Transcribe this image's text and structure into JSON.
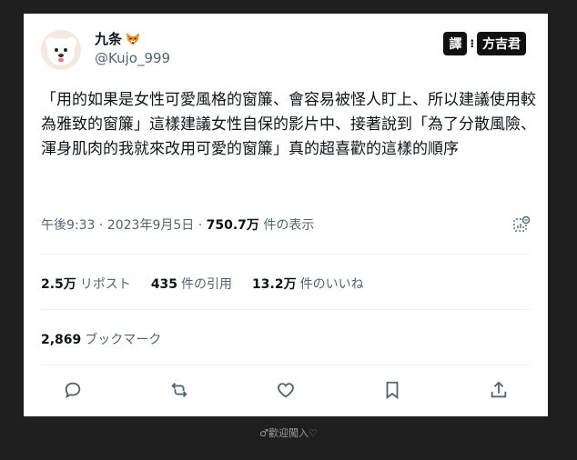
{
  "user": {
    "display_name": "九条",
    "handle": "@Kujo_999",
    "name_emoji": "fox-face-icon"
  },
  "watermark": {
    "left": "譯",
    "separator": "⁝",
    "right": "方吉君"
  },
  "tweet": {
    "text": "「用的如果是女性可愛風格的窗簾、會容易被怪人盯上、所以建議使用較為雅致的窗簾」這樣建議女性自保的影片中、接著說到「為了分散風險、渾身肌肉的我就來改用可愛的窗簾」真的超喜歡的這樣的順序"
  },
  "meta": {
    "time": "午後9:33",
    "sep1": " · ",
    "date": "2023年9月5日",
    "sep2": " · ",
    "views_count": "750.7万",
    "views_label": " 件の表示"
  },
  "stats": {
    "reposts_count": "2.5万",
    "reposts_label": "リポスト",
    "quotes_count": "435",
    "quotes_label": "件の引用",
    "likes_count": "13.2万",
    "likes_label": "件のいいね"
  },
  "bookmarks": {
    "count": "2,869",
    "label": "ブックマーク"
  },
  "caption": "♂歡迎闖入♡",
  "colors": {
    "text": "#0f1419",
    "secondary": "#536471",
    "divider": "#eff3f4",
    "background": "#1f1f1f"
  }
}
